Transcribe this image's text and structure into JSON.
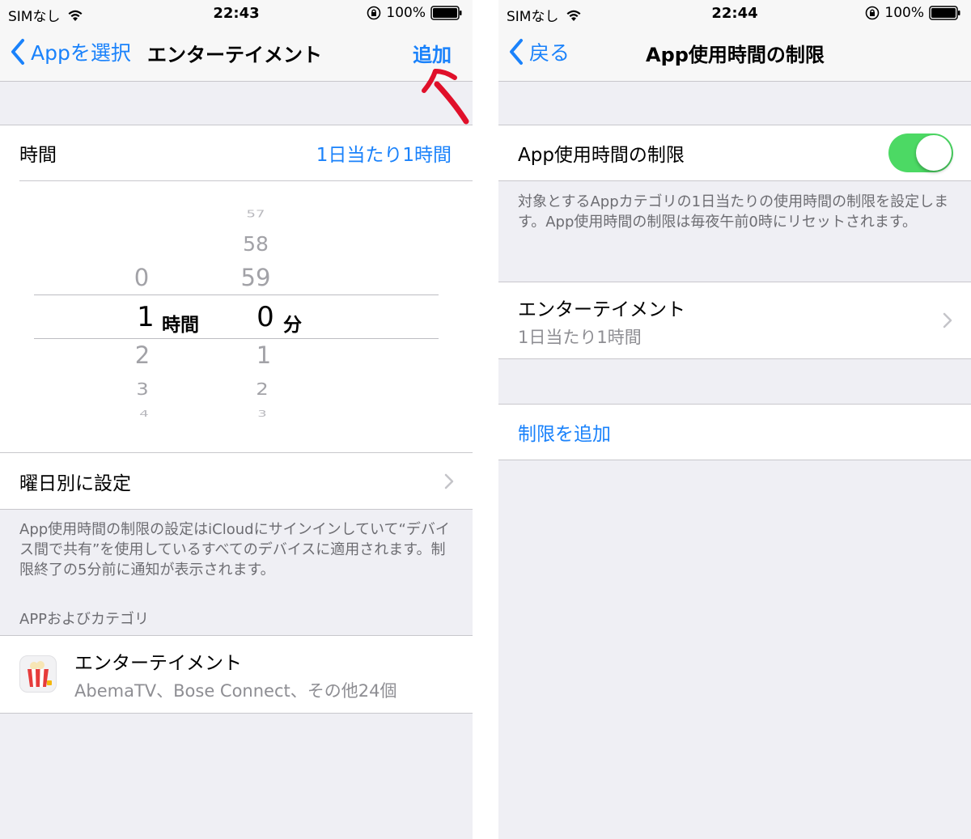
{
  "colors": {
    "accent": "#1a82fb",
    "toggle_on": "#4cd964",
    "annotation_arrow": "#e0102a"
  },
  "left": {
    "status": {
      "carrier": "SIMなし",
      "time": "22:43",
      "battery": "100%"
    },
    "nav": {
      "back_label": "Appを選択",
      "title": "エンターテイメント",
      "action_label": "追加"
    },
    "time_row": {
      "label": "時間",
      "value": "1日当たり1時間"
    },
    "picker": {
      "hours": {
        "above": [
          "0"
        ],
        "selected": "1",
        "below": [
          "2",
          "3",
          "4"
        ],
        "unit": "時間"
      },
      "minutes": {
        "above": [
          "57",
          "58",
          "59"
        ],
        "selected": "0",
        "below": [
          "1",
          "2",
          "3"
        ],
        "unit": "分"
      }
    },
    "weekday_row": {
      "label": "曜日別に設定"
    },
    "footnote": "App使用時間の制限の設定はiCloudにサインインしていて“デバイス間で共有”を使用しているすべてのデバイスに適用されます。制限終了の5分前に通知が表示されます。",
    "section_header": "APPおよびカテゴリ",
    "category": {
      "title": "エンターテイメント",
      "subtitle": "AbemaTV、Bose Connect、その他24個",
      "icon": "popcorn-icon"
    }
  },
  "right": {
    "status": {
      "carrier": "SIMなし",
      "time": "22:44",
      "battery": "100%"
    },
    "nav": {
      "back_label": "戻る",
      "title": "App使用時間の制限"
    },
    "toggle_row": {
      "label": "App使用時間の制限",
      "state": "on"
    },
    "footnote": "対象とするAppカテゴリの1日当たりの使用時間の制限を設定します。App使用時間の制限は毎夜午前0時にリセットされます。",
    "limit_row": {
      "title": "エンターテイメント",
      "subtitle": "1日当たり1時間"
    },
    "add_limit_label": "制限を追加"
  }
}
